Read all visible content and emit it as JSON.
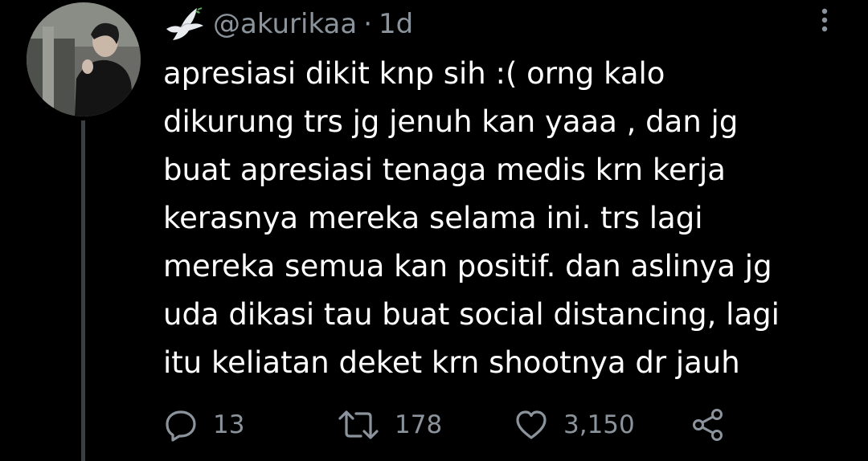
{
  "tweet": {
    "handle": "@akurikaa",
    "separator": "·",
    "time": "1d",
    "text_lines": [
      "apresiasi dikit knp sih :( orng kalo",
      "dikurung trs jg jenuh kan yaaa , dan jg",
      "buat apresiasi tenaga medis krn kerja",
      "kerasnya mereka selama ini. trs lagi",
      "mereka semua kan positif. dan aslinya jg",
      "uda dikasi tau buat social distancing, lagi",
      "itu keliatan deket krn shootnya dr jauh"
    ],
    "actions": {
      "reply_count": "13",
      "retweet_count": "178",
      "like_count": "3,150"
    }
  },
  "icons": {
    "name_emoji": "dove-icon",
    "more": "more-vertical-icon",
    "reply": "reply-icon",
    "retweet": "retweet-icon",
    "like": "heart-icon",
    "share": "share-icon"
  },
  "colors": {
    "background": "#000000",
    "text": "#ffffff",
    "secondary": "#8b949c",
    "thread_line": "#3b3e42"
  }
}
